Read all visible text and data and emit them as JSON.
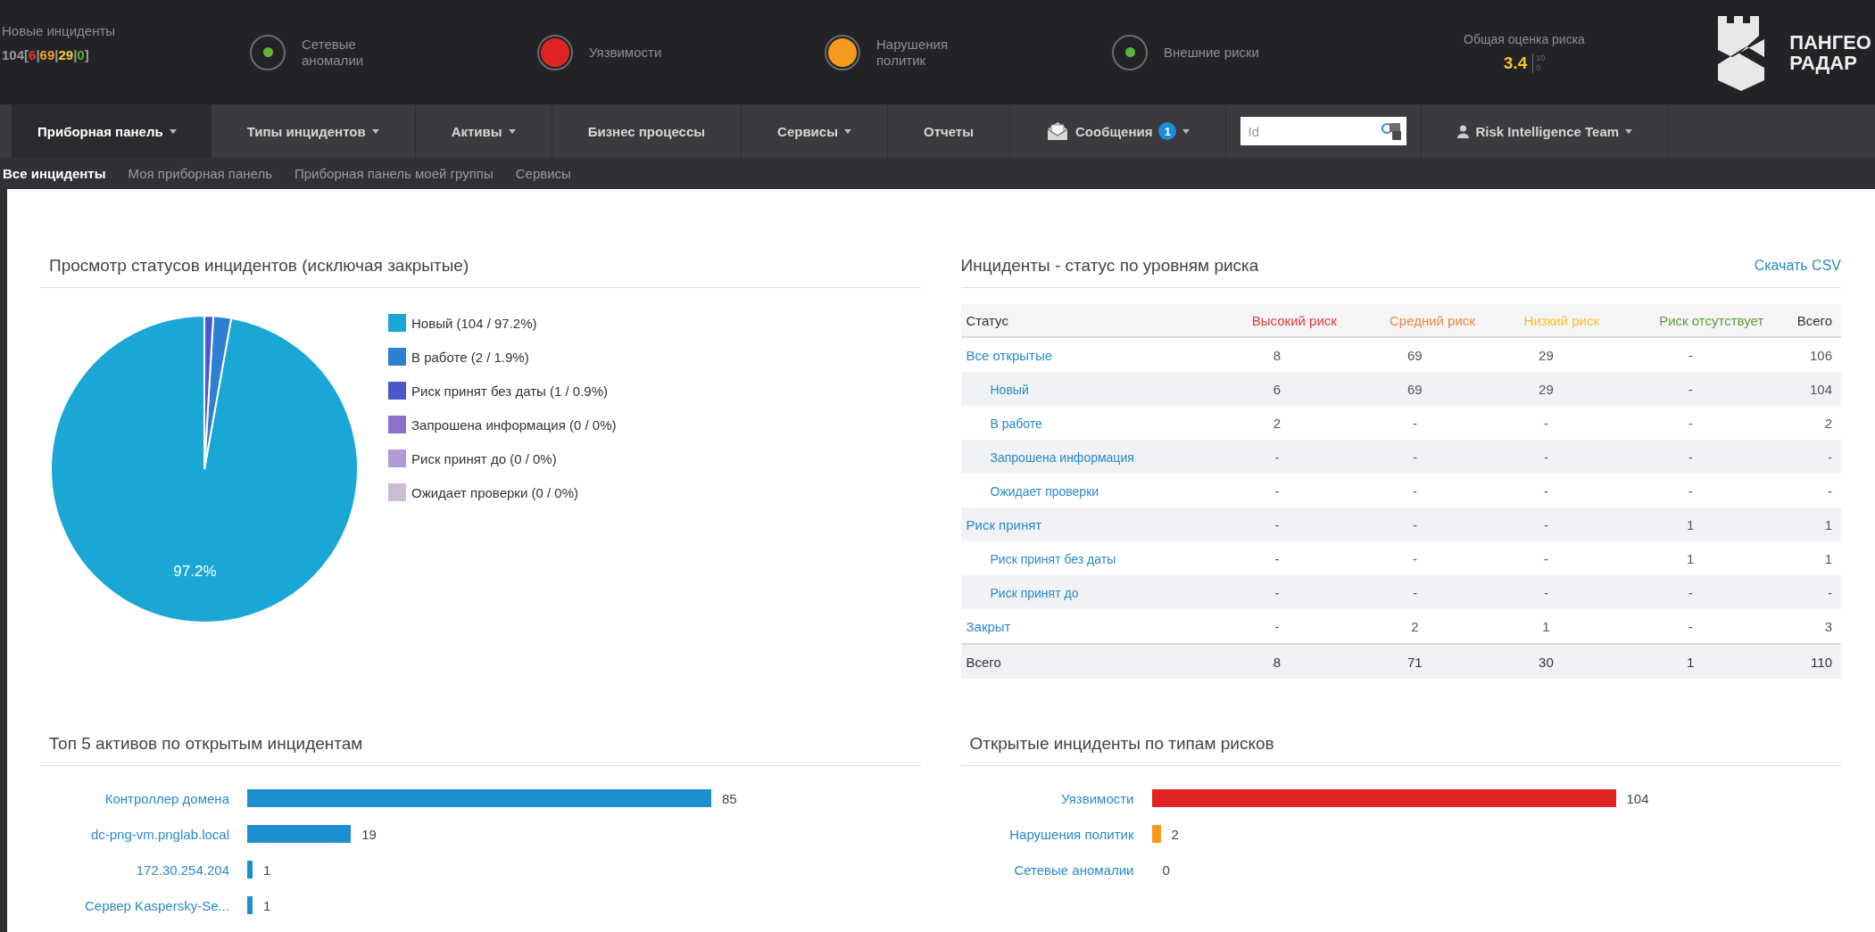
{
  "top_bar": {
    "new_incidents": {
      "label": "Новые инциденты",
      "segments": [
        {
          "text": "104[",
          "color": "#9a9a9a"
        },
        {
          "text": "6",
          "color": "#e53935"
        },
        {
          "text": "|",
          "color": "#9a9a9a"
        },
        {
          "text": "69",
          "color": "#f5a623"
        },
        {
          "text": "|",
          "color": "#9a9a9a"
        },
        {
          "text": "29",
          "color": "#f3d02e"
        },
        {
          "text": "|",
          "color": "#9a9a9a"
        },
        {
          "text": "0",
          "color": "#5cb338"
        },
        {
          "text": "]",
          "color": "#9a9a9a"
        }
      ]
    },
    "indicators": [
      {
        "label": "Сетевые\nаномалии",
        "kind": "dot",
        "color": "#5cb338"
      },
      {
        "label": "Уязвимости",
        "kind": "filled",
        "color": "#e02424"
      },
      {
        "label": "Нарушения\nполитик",
        "kind": "filled",
        "color": "#f59a1f"
      },
      {
        "label": "Внешние риски",
        "kind": "dot",
        "color": "#5cb338"
      }
    ],
    "risk_score": {
      "label": "Общая оценка риска",
      "value": "3.4",
      "max": "10",
      "min": "0"
    },
    "logo": {
      "line1": "ПАНГЕО",
      "line2": "РАДАР"
    }
  },
  "nav": {
    "tabs": [
      {
        "label": "Приборная панель",
        "kind": "tab",
        "dropdown": true,
        "selected": true
      },
      {
        "label": "Типы инцидентов",
        "kind": "tab",
        "dropdown": true,
        "selected": false
      },
      {
        "label": "Активы",
        "kind": "tab",
        "dropdown": true,
        "selected": false
      },
      {
        "label": "Бизнес процессы",
        "kind": "tab",
        "dropdown": false,
        "selected": false
      },
      {
        "label": "Сервисы",
        "kind": "tab",
        "dropdown": true,
        "selected": false
      },
      {
        "label": "Отчеты",
        "kind": "tab",
        "dropdown": false,
        "selected": false
      },
      {
        "label": "Сообщения",
        "kind": "messages",
        "badge": "1",
        "dropdown": true,
        "selected": false
      }
    ],
    "search": {
      "placeholder": "Id"
    },
    "user": {
      "label": "Risk Intelligence Team",
      "dropdown": true
    }
  },
  "subnav": [
    {
      "label": "Все инциденты",
      "selected": true
    },
    {
      "label": "Моя приборная панель",
      "selected": false
    },
    {
      "label": "Приборная панель моей группы",
      "selected": false
    },
    {
      "label": "Сервисы",
      "selected": false
    }
  ],
  "status_panel": {
    "title": "Просмотр статусов инцидентов (исключая закрытые)",
    "chart_data": {
      "type": "pie",
      "categories": [
        "Новый (104 / 97.2%)",
        "В работе (2 / 1.9%)",
        "Риск принят без даты (1 / 0.9%)",
        "Запрошена информация (0 / 0%)",
        "Риск принят до (0 / 0%)",
        "Ожидает проверки (0 / 0%)"
      ],
      "series": [
        {
          "values": [
            104,
            2,
            1,
            0,
            0,
            0
          ]
        }
      ],
      "legend": "right",
      "colors": [
        "#1aa7d6",
        "#2d7fd1",
        "#4a59c9",
        "#8a72cc",
        "#b09bd6",
        "#cbbcd3"
      ],
      "value_labels": [
        "97.2%",
        null,
        null,
        null,
        null,
        null
      ]
    }
  },
  "risk_table": {
    "title": "Инциденты - статус по уровням риска",
    "download_link": "Скачать CSV",
    "columns": [
      {
        "label": "Статус"
      },
      {
        "label": "Высокий риск",
        "color": "#e03a3a"
      },
      {
        "label": "Средний риск",
        "color": "#f0883a"
      },
      {
        "label": "Низкий риск",
        "color": "#f3c12e"
      },
      {
        "label": "Риск отсутствует",
        "color": "#5a9e3a"
      },
      {
        "label": "Всего"
      }
    ],
    "rows": [
      {
        "status": "Все открытые",
        "values": [
          "8",
          "69",
          "29",
          "-",
          "106"
        ],
        "children": [
          {
            "status": "Новый",
            "values": [
              "6",
              "69",
              "29",
              "-",
              "104"
            ]
          },
          {
            "status": "В работе",
            "values": [
              "2",
              "-",
              "-",
              "-",
              "2"
            ]
          },
          {
            "status": "Запрошена информация",
            "values": [
              "-",
              "-",
              "-",
              "-",
              "-"
            ]
          },
          {
            "status": "Ожидает проверки",
            "values": [
              "-",
              "-",
              "-",
              "-",
              "-"
            ]
          }
        ]
      },
      {
        "status": "Риск принят",
        "values": [
          "-",
          "-",
          "-",
          "1",
          "1"
        ],
        "children": [
          {
            "status": "Риск принят без даты",
            "values": [
              "-",
              "-",
              "-",
              "1",
              "1"
            ]
          },
          {
            "status": "Риск принят до",
            "values": [
              "-",
              "-",
              "-",
              "-",
              "-"
            ]
          }
        ]
      },
      {
        "status": "Закрыт",
        "values": [
          "-",
          "2",
          "1",
          "-",
          "3"
        ]
      }
    ],
    "total": {
      "status": "Всего",
      "values": [
        "8",
        "71",
        "30",
        "1",
        "110"
      ]
    }
  },
  "top_assets": {
    "title": "Топ 5 активов по открытым инцидентам",
    "chart_data": {
      "type": "bar",
      "orientation": "horizontal",
      "categories": [
        "Контроллер домена",
        "dc-png-vm.pnglab.local",
        "172.30.254.204",
        "Сервер Kaspersky-Se..."
      ],
      "series": [
        {
          "color": "#1b8fd0",
          "values": [
            85,
            19,
            1,
            1
          ]
        }
      ],
      "data_labels": true
    }
  },
  "risk_types": {
    "title": "Открытые инциденты по типам рисков",
    "chart_data": {
      "type": "bar",
      "orientation": "horizontal",
      "categories": [
        "Уязвимости",
        "Нарушения политик",
        "Сетевые аномалии"
      ],
      "series": [
        {
          "values": [
            104,
            2,
            0
          ]
        }
      ],
      "colors": [
        "#e02424",
        "#f59a1f",
        "#5cb338"
      ],
      "data_labels": true
    }
  }
}
